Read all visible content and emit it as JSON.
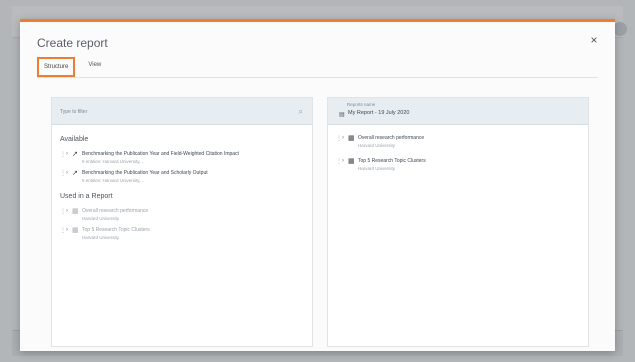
{
  "dialog": {
    "title": "Create report",
    "close_label": "×",
    "tabs": [
      {
        "label": "Structure",
        "active": true
      },
      {
        "label": "View",
        "active": false
      }
    ]
  },
  "left_pane": {
    "filter_placeholder": "Type to filter",
    "filter_icon": "search-icon",
    "available_title": "Available",
    "available_items": [
      {
        "name": "Benchmarking the Publication Year and Field-Weighted Citation Impact",
        "sub": "5 entities: Harvard University,..."
      },
      {
        "name": "Benchmarking the Publication Year and Scholarly Output",
        "sub": "5 entities: Harvard University,..."
      }
    ],
    "used_title": "Used in a Report",
    "used_items": [
      {
        "name": "Overall research performance",
        "sub": "Harvard University"
      },
      {
        "name": "Top 5 Research Topic Clusters",
        "sub": "Harvard University"
      }
    ]
  },
  "right_pane": {
    "report_name_label": "Reports name",
    "report_name_value": "My Report - 19 July 2020",
    "items": [
      {
        "name": "Overall research performance",
        "sub": "Harvard University"
      },
      {
        "name": "Top 5 Research Topic Clusters",
        "sub": "Harvard University"
      }
    ]
  },
  "colors": {
    "accent": "#ed7d31"
  }
}
